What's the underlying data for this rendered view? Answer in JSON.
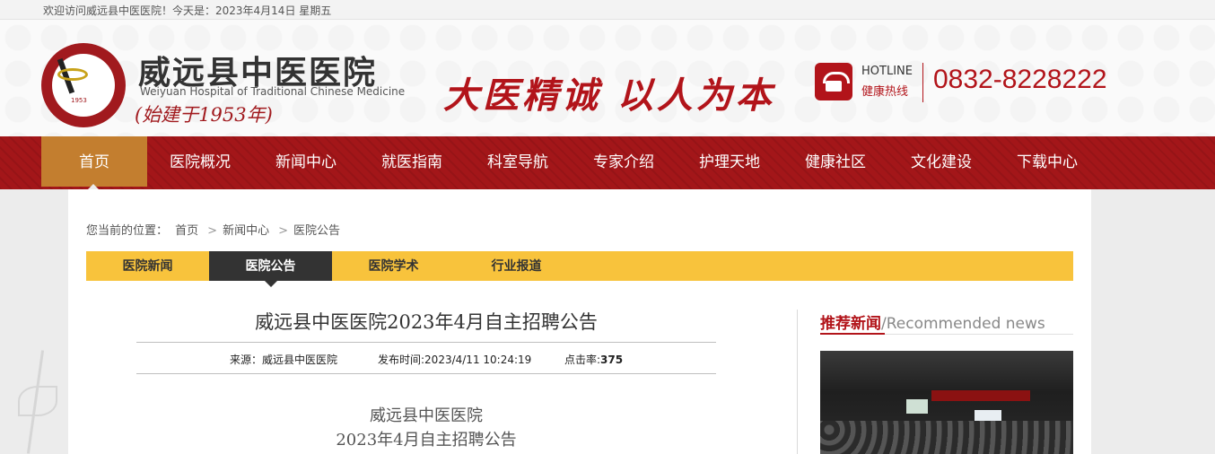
{
  "topbar": {
    "welcome": "欢迎访问威远县中医医院！今天是：2023年4月14日  星期五"
  },
  "header": {
    "logo_year": "1953",
    "site_name": "威远县中医医院",
    "site_name_en": "Weiyuan Hospital of Traditional Chinese Medicine",
    "since": "(始建于1953年)",
    "slogan": "大医精诚  以人为本",
    "hotline_en": "HOTLINE",
    "hotline_cn": "健康热线",
    "hotline_number": "0832-8228222"
  },
  "nav": {
    "items": [
      {
        "label": "首页"
      },
      {
        "label": "医院概况"
      },
      {
        "label": "新闻中心"
      },
      {
        "label": "就医指南"
      },
      {
        "label": "科室导航"
      },
      {
        "label": "专家介绍"
      },
      {
        "label": "护理天地"
      },
      {
        "label": "健康社区"
      },
      {
        "label": "文化建设"
      },
      {
        "label": "下载中心"
      }
    ],
    "active_index": 0
  },
  "breadcrumb": {
    "prefix": "您当前的位置：",
    "items": [
      "首页",
      "新闻中心",
      "医院公告"
    ],
    "separator": ">"
  },
  "subnav": {
    "tabs": [
      {
        "label": "医院新闻"
      },
      {
        "label": "医院公告"
      },
      {
        "label": "医院学术"
      },
      {
        "label": "行业报道"
      }
    ],
    "active_index": 1
  },
  "article": {
    "title": "威远县中医医院2023年4月自主招聘公告",
    "source": "来源：威远县中医医院",
    "published": "发布时间:2023/4/11 10:24:19",
    "clicks_label": "点击率:",
    "clicks": "375",
    "body_line_1": "威远县中医医院",
    "body_line_2": "2023年4月自主招聘公告"
  },
  "recommended": {
    "title_cn": "推荐新闻",
    "title_en": "/Recommended news"
  },
  "colors": {
    "brand_red": "#a31619",
    "active_nav": "#c37e2f",
    "subnav_yellow": "#f8c33c",
    "subnav_active": "#333333"
  }
}
